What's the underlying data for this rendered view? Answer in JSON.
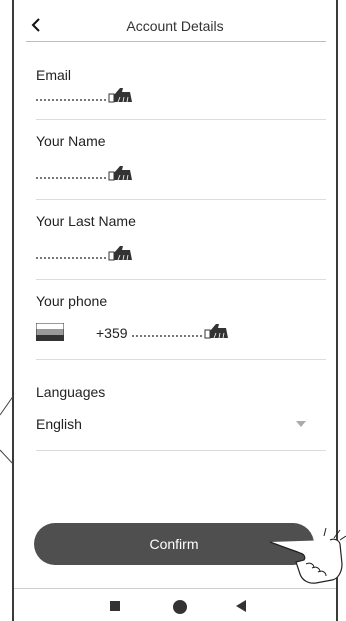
{
  "header": {
    "title": "Account Details",
    "back_icon": "chevron-left-icon"
  },
  "form": {
    "email": {
      "label": "Email"
    },
    "first_name": {
      "label": "Your Name"
    },
    "last_name": {
      "label": "Your Last Name"
    },
    "phone": {
      "label": "Your phone",
      "prefix": "+359",
      "flag_icon": "flag-icon"
    },
    "languages": {
      "label": "Languages",
      "value": "English",
      "caret_icon": "caret-down-icon"
    },
    "input_hint_icon": "pointing-hand-icon"
  },
  "actions": {
    "confirm_label": "Confirm",
    "tap_indicator_icon": "tapping-hand-icon"
  },
  "navbar": {
    "recent_icon": "square-recent-apps-icon",
    "home_icon": "circle-home-icon",
    "back_icon": "triangle-back-icon"
  },
  "colors": {
    "button_bg": "#4f4f4f",
    "divider": "#dcdcdc",
    "text": "#222222"
  }
}
